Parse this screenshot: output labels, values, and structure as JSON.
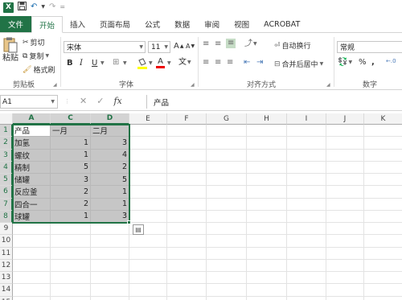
{
  "qat": {
    "logo": "X",
    "save_icon": "save-icon",
    "undo_icon": "undo-icon",
    "redo_icon": "redo-icon",
    "customize": "="
  },
  "tabs": [
    {
      "label": "文件"
    },
    {
      "label": "开始"
    },
    {
      "label": "插入"
    },
    {
      "label": "页面布局"
    },
    {
      "label": "公式"
    },
    {
      "label": "数据"
    },
    {
      "label": "审阅"
    },
    {
      "label": "视图"
    },
    {
      "label": "ACROBAT"
    }
  ],
  "ribbon": {
    "clipboard": {
      "paste": "粘贴",
      "cut": "剪切",
      "copy": "复制",
      "format_painter": "格式刷",
      "label": "剪贴板"
    },
    "font": {
      "name": "宋体",
      "size": "11",
      "bold": "B",
      "italic": "I",
      "underline": "U",
      "grow": "A",
      "shrink": "A",
      "font_color": "A",
      "phonetic": "文",
      "label": "字体"
    },
    "alignment": {
      "wrap": "自动换行",
      "merge": "合并后居中",
      "label": "对齐方式"
    },
    "number": {
      "format": "常规",
      "percent": "%",
      "comma": ",",
      "label": "数字"
    }
  },
  "formula_bar": {
    "name_box": "A1",
    "fx": "fx",
    "content": "产品"
  },
  "columns": [
    "A",
    "C",
    "D",
    "E",
    "F",
    "G",
    "H",
    "I",
    "J",
    "K"
  ],
  "rows": [
    "1",
    "2",
    "3",
    "4",
    "5",
    "6",
    "7",
    "8",
    "9",
    "10",
    "11",
    "12",
    "13",
    "14",
    "15"
  ],
  "sheet": [
    [
      "产品",
      "一月",
      "二月"
    ],
    [
      "加氢",
      "1",
      "3"
    ],
    [
      "螺纹",
      "1",
      "4"
    ],
    [
      "精制",
      "5",
      "2"
    ],
    [
      "储罐",
      "3",
      "5"
    ],
    [
      "反应釜",
      "2",
      "1"
    ],
    [
      "四合一",
      "2",
      "1"
    ],
    [
      "球罐",
      "1",
      "3"
    ]
  ],
  "colors": {
    "accent": "#217346",
    "selection": "#c6c6c6"
  }
}
